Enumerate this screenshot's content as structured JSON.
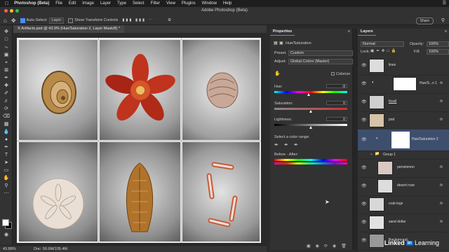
{
  "menubar": {
    "apple": "",
    "app": "Photoshop (Beta)",
    "items": [
      "File",
      "Edit",
      "Image",
      "Layer",
      "Type",
      "Select",
      "Filter",
      "View",
      "Plugins",
      "Window",
      "Help"
    ]
  },
  "window": {
    "title": "Adobe Photoshop (Beta)"
  },
  "options": {
    "auto_select_label": "Auto-Select:",
    "auto_select_value": "Layer",
    "show_transform_label": "Show Transform Controls",
    "share_label": "Share"
  },
  "document": {
    "tab_label": "© Artifacts.psd @ 43.9% (Hue/Saturation 2, Layer Mask/8) *",
    "zoom": "43.88%",
    "doc_info": "Doc: 50.6M/105.4M"
  },
  "properties": {
    "tab": "Properties",
    "adjustment_name": "Hue/Saturation",
    "preset_label": "Preset:",
    "preset_value": "Custom",
    "adjust_label": "Adjust:",
    "adjust_value": "Global Colors (Master)",
    "colorize_label": "Colorize",
    "hue_label": "Hue:",
    "hue_value": "-9",
    "saturation_label": "Saturation:",
    "saturation_value": "0",
    "lightness_label": "Lightness:",
    "lightness_value": "0",
    "select_range_label": "Select a color range:",
    "before_after_label": "Before - After:",
    "hue_level": -9,
    "saturation_level": 0,
    "lightness_level": 0
  },
  "layers": {
    "tab": "Layers",
    "blend_mode": "Normal",
    "opacity_label": "Opacity:",
    "opacity_value": "100%",
    "lock_label": "Lock:",
    "fill_label": "Fill:",
    "fill_value": "100%",
    "items": [
      {
        "name": "lines",
        "fx": ""
      },
      {
        "name": "Hue/S...n 1",
        "fx": "fx"
      },
      {
        "name": "fossil",
        "fx": "fx"
      },
      {
        "name": "pod",
        "fx": "fx"
      },
      {
        "name": "Hue/Saturation 2",
        "fx": ""
      },
      {
        "name": "Group 1",
        "fx": ""
      },
      {
        "name": "persimmon",
        "fx": "fx"
      },
      {
        "name": "desert rose",
        "fx": "fx"
      },
      {
        "name": "crab legs",
        "fx": "fx"
      },
      {
        "name": "sand dollar",
        "fx": "fx"
      },
      {
        "name": "Background",
        "fx": ""
      }
    ]
  },
  "watermark": {
    "brand": "Linked",
    "in": "in",
    "suffix": "Learning"
  },
  "colors": {
    "accent": "#4a8cff",
    "selected_row": "#3e4f6e"
  }
}
